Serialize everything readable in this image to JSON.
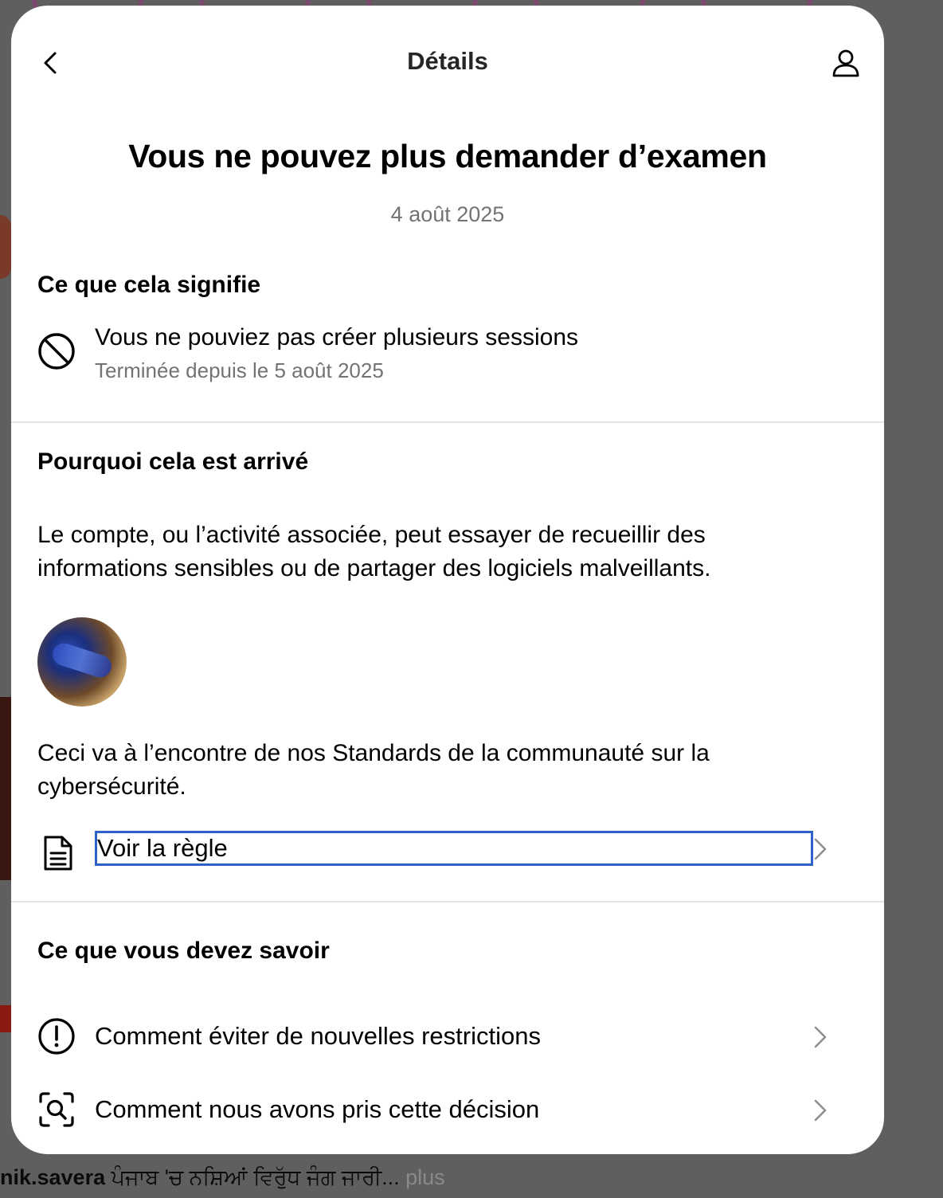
{
  "background": {
    "caption_user": "nik.savera",
    "caption_text": " ਪੰਜਾਬ 'ਚ ਨਸ਼ਿਆਂ ਵਿਰੁੱਧ ਜੰਗ ਜਾਰੀ...",
    "caption_more": " plus"
  },
  "header": {
    "title": "Détails"
  },
  "main": {
    "title": "Vous ne pouvez plus demander d’examen",
    "date": "4 août 2025"
  },
  "meaning": {
    "title": "Ce que cela signifie",
    "restriction_text": "Vous ne pouviez pas créer plusieurs sessions",
    "restriction_status": "Terminée depuis le 5 août 2025"
  },
  "why": {
    "title": "Pourquoi cela est arrivé",
    "paragraph": "Le compte, ou l’activité associée, peut essayer de recueillir des informations sensibles ou de partager des logiciels malveillants.",
    "standards_text": "Ceci va à l’encontre de nos Standards de la communauté sur la cybersécurité.",
    "rule_link": "Voir la règle"
  },
  "know": {
    "title": "Ce que vous devez savoir",
    "items": [
      {
        "label": "Comment éviter de nouvelles restrictions",
        "icon": "exclamation-circle-icon"
      },
      {
        "label": "Comment nous avons pris cette décision",
        "icon": "scan-search-icon"
      }
    ]
  },
  "colors": {
    "focus_ring": "#2f62c8",
    "muted_text": "#737373",
    "overlay": "#5f5f5f"
  }
}
